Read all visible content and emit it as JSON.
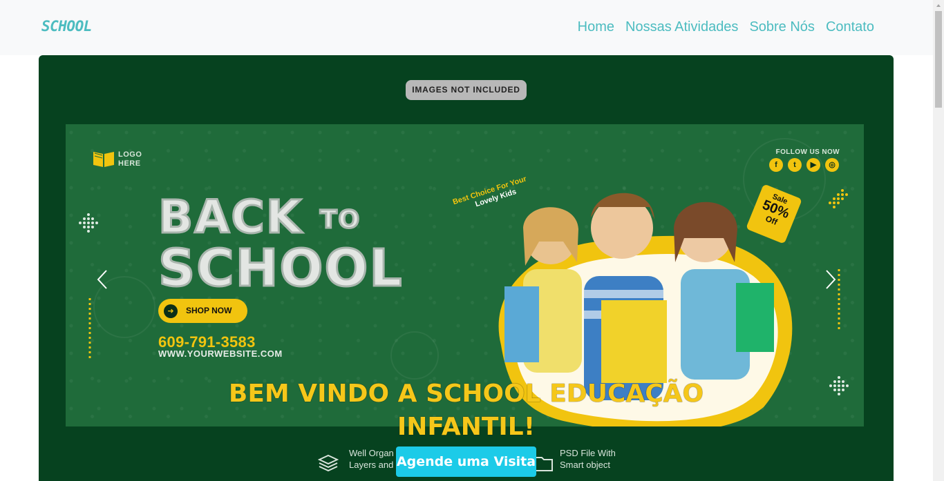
{
  "navbar": {
    "brand": "SCHOOL",
    "links": [
      "Home",
      "Nossas Atividades",
      "Sobre Nós",
      "Contato"
    ]
  },
  "hero": {
    "badge": "IMAGES NOT INCLUDED",
    "banner": {
      "logo_line1": "LOGO",
      "logo_line2": "HERE",
      "title_line1": "BACK",
      "title_to": "TO",
      "title_line2": "SCHOOL",
      "shop_label": "SHOP NOW",
      "phone": "609-791-3583",
      "website": "WWW.YOURWEBSITE.COM",
      "follow": "FOLLOW US NOW",
      "social_icons": [
        "facebook-icon",
        "twitter-icon",
        "youtube-icon",
        "instagram-icon"
      ],
      "tagline_1": "Best Choice For Your",
      "tagline_2": "Lovely Kids",
      "sale_1": "Sale",
      "sale_2": "50%",
      "sale_3": "Off"
    },
    "welcome_line1": "BEM VINDO A SCHOOL EDUCAÇÃO",
    "welcome_line2": "INFANTIL!",
    "feature_left_1": "Well Organ",
    "feature_left_2": "Layers and",
    "feature_right_1": "PSD File With",
    "feature_right_2": "Smart object",
    "cta_label": "Agende uma Visita"
  },
  "colors": {
    "brand": "#4cbcc0",
    "hero_bg": "#06421f",
    "accent_yellow": "#f5c71a",
    "cta": "#1ccbe8"
  }
}
